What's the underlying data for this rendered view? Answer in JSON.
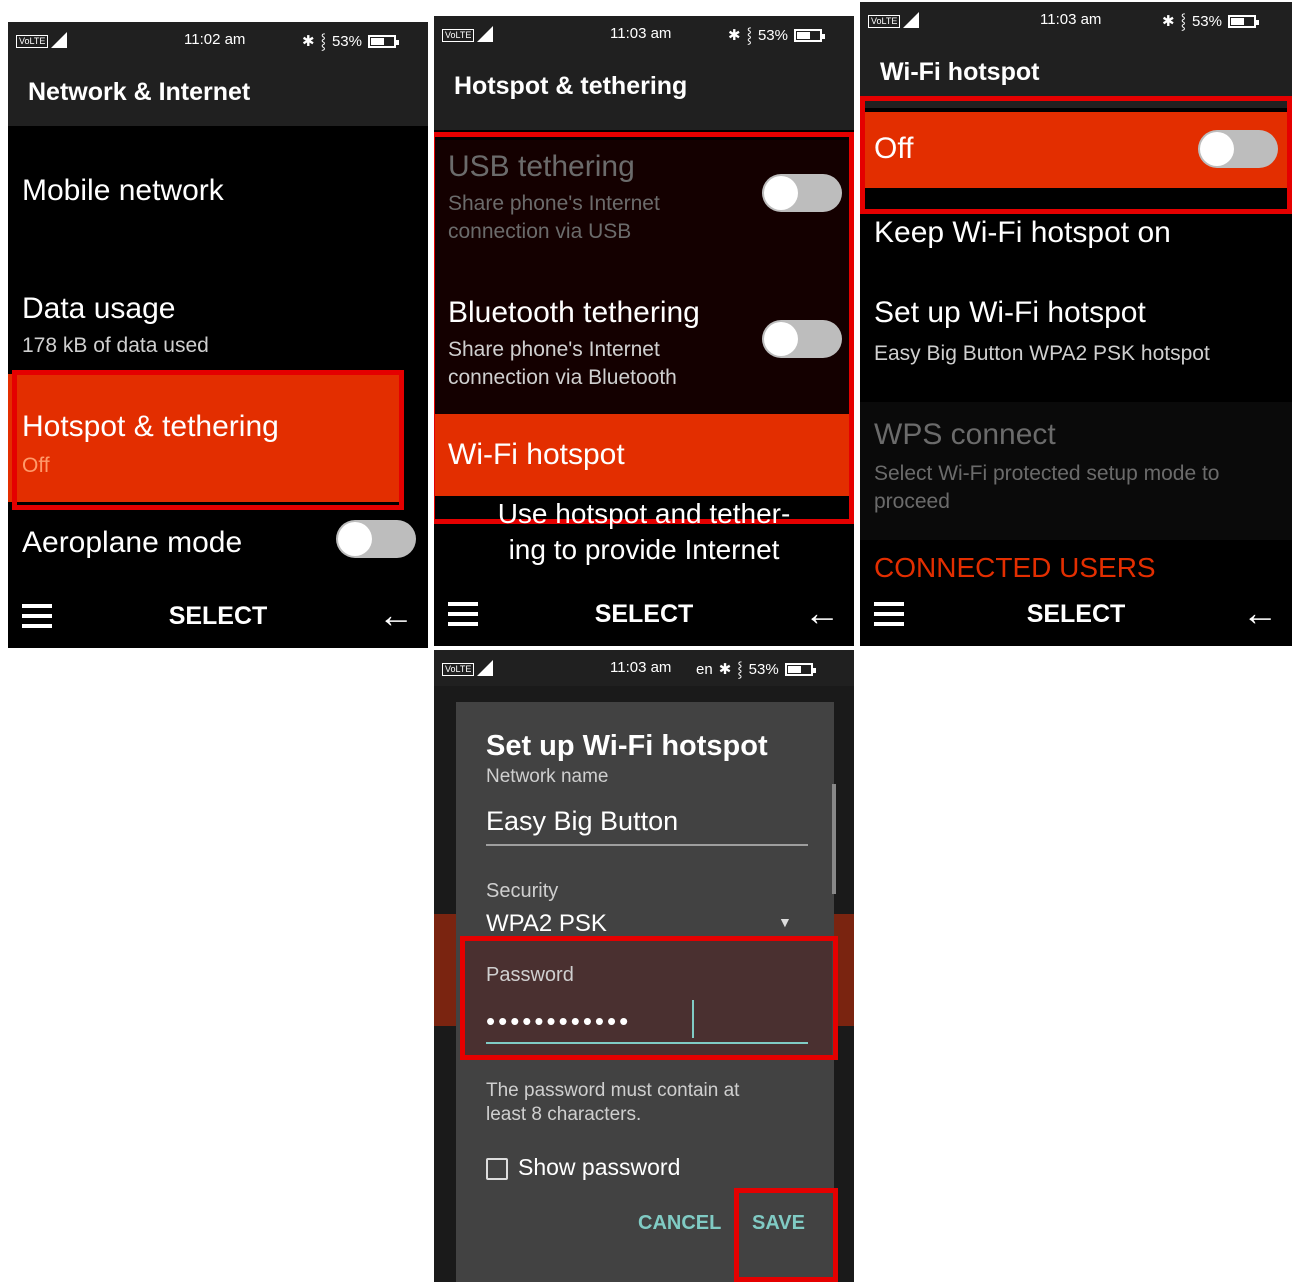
{
  "status": {
    "volte": "VoLTE",
    "network": "4G",
    "battery": "53%",
    "bt_icon": "bluetooth-icon",
    "vib_icon": "vibrate-icon",
    "time1": "11:02 am",
    "time2": "11:03 am",
    "time3": "11:03 am",
    "time4": "11:03 am",
    "lang": "en"
  },
  "softkeys": {
    "select": "SELECT",
    "menu_icon": "menu-icon",
    "back_icon": "back-arrow-icon"
  },
  "screen1": {
    "title": "Network & Internet",
    "items": [
      {
        "title": "Mobile network"
      },
      {
        "title": "Data usage",
        "sub": "178 kB of data used"
      },
      {
        "title": "Hotspot & tethering",
        "sub": "Off"
      },
      {
        "title": "Aeroplane mode"
      }
    ]
  },
  "screen2": {
    "title": "Hotspot & tethering",
    "items": [
      {
        "title": "USB tethering",
        "sub1": "Share phone's Internet",
        "sub2": "connection via USB"
      },
      {
        "title": "Bluetooth tethering",
        "sub1": "Share phone's Internet",
        "sub2": "connection via Bluetooth"
      },
      {
        "title": "Wi-Fi hotspot"
      }
    ],
    "footer1": "Use hotspot and tether-",
    "footer2": "ing to provide Internet"
  },
  "screen3": {
    "title": "Wi-Fi hotspot",
    "items": [
      {
        "title": "Off"
      },
      {
        "title": "Keep Wi-Fi hotspot on"
      },
      {
        "title": "Set up Wi-Fi hotspot",
        "sub": "Easy Big Button WPA2 PSK hotspot"
      },
      {
        "title": "WPS connect",
        "sub1": "Select Wi-Fi protected setup mode to",
        "sub2": "proceed"
      }
    ],
    "section": "CONNECTED USERS"
  },
  "screen4": {
    "dialog_title": "Set up Wi-Fi hotspot",
    "network_label": "Network name",
    "network_value": "Easy Big Button",
    "security_label": "Security",
    "security_value": "WPA2 PSK",
    "password_label": "Password",
    "password_value": "••••••••••••",
    "hint1": "The password must contain at",
    "hint2": "least 8 characters.",
    "show_password": "Show password",
    "cancel": "CANCEL",
    "save": "SAVE"
  },
  "colors": {
    "accent": "#e32e00",
    "highlight_box": "#e50000",
    "teal": "#80cbc4"
  }
}
